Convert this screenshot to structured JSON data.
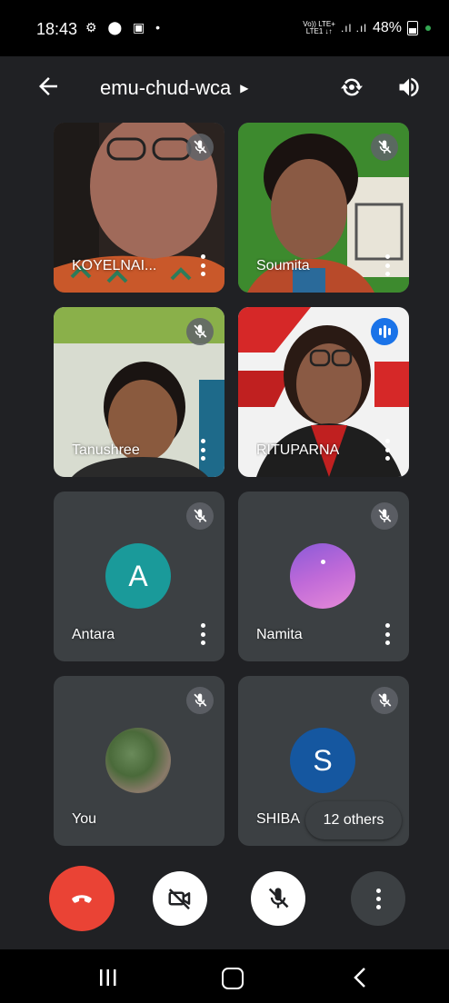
{
  "status_bar": {
    "time": "18:43",
    "network_top": "Vo)) LTE+",
    "network_bottom": "LTE1 ↓↑",
    "battery": "48%"
  },
  "header": {
    "meeting_code": "emu-chud-wca",
    "back_icon": "arrow-left-icon",
    "switch_camera_icon": "switch-camera-icon",
    "speaker_icon": "speaker-icon"
  },
  "participants": [
    {
      "name": "KOYELNAI...",
      "type": "video",
      "muted": true
    },
    {
      "name": "Soumita",
      "type": "video",
      "muted": true
    },
    {
      "name": "Tanushree",
      "type": "video",
      "muted": true
    },
    {
      "name": "RITUPARNA",
      "type": "video",
      "speaking": true
    },
    {
      "name": "Antara",
      "type": "initial",
      "initial": "A",
      "avatar_color": "#1a9a9a",
      "muted": true
    },
    {
      "name": "Namita",
      "type": "photo",
      "muted": true
    },
    {
      "name": "You",
      "type": "photo",
      "muted": true
    },
    {
      "name": "SHIBA",
      "type": "initial",
      "initial": "S",
      "avatar_color": "#1557a0",
      "muted": true
    }
  ],
  "others_chip": "12 others",
  "controls": {
    "hangup_icon": "hang-up-icon",
    "camera_icon": "camera-off-icon",
    "mic_icon": "mic-off-icon",
    "more_icon": "more-vertical-icon"
  },
  "colors": {
    "background": "#202124",
    "tile": "#3c4043",
    "hangup": "#ea4335",
    "speaking": "#1a73e8"
  }
}
